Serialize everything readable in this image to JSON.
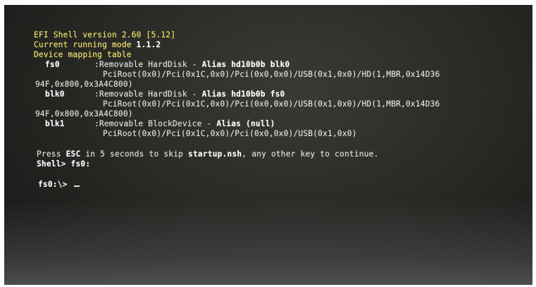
{
  "shell": {
    "version_line": "EFI Shell version 2.60 [5.12]",
    "mode_label": "Current running mode ",
    "mode_value": "1.1.2",
    "mapping_title": "Device mapping table"
  },
  "devices": [
    {
      "name": "fs0",
      "desc": ":Removable HardDisk - ",
      "alias": "Alias hd10b0b blk0",
      "path1": "PciRoot(0x0)/Pci(0x1C,0x0)/Pci(0x0,0x0)/USB(0x1,0x0)/HD(1,MBR,0x14D36",
      "path2": "94F,0x800,0x3A4C800)"
    },
    {
      "name": "blk0",
      "desc": ":Removable HardDisk - ",
      "alias": "Alias hd10b0b fs0",
      "path1": "PciRoot(0x0)/Pci(0x1C,0x0)/Pci(0x0,0x0)/USB(0x1,0x0)/HD(1,MBR,0x14D36",
      "path2": "94F,0x800,0x3A4C800)"
    },
    {
      "name": "blk1",
      "desc": ":Removable BlockDevice - ",
      "alias": "Alias (null)",
      "path1": "PciRoot(0x0)/Pci(0x1C,0x0)/Pci(0x0,0x0)/USB(0x1,0x0)",
      "path2": ""
    }
  ],
  "startup": {
    "press": "Press ",
    "esc": "ESC",
    "middle": " in 5 seconds to skip ",
    "script": "startup.nsh",
    "end": ", any other key to continue."
  },
  "prompt": {
    "shell_cmd": "Shell> fs0:",
    "current": "fs0:\\> "
  }
}
